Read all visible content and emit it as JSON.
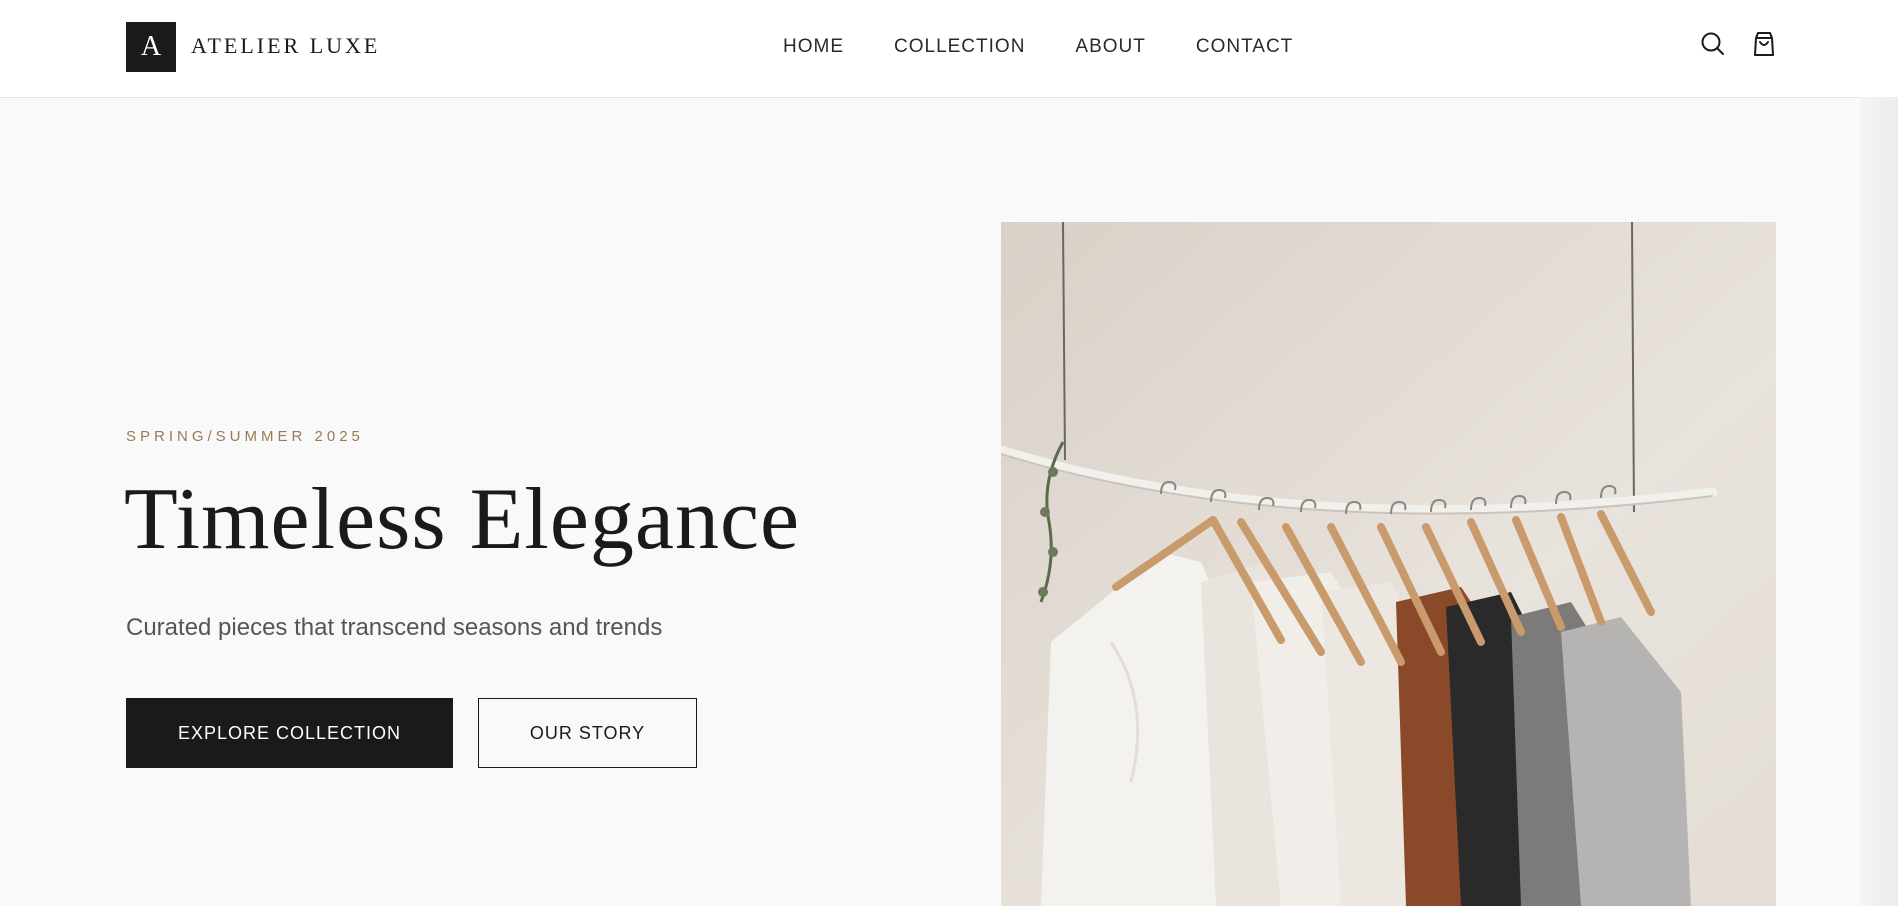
{
  "brand": {
    "mark": "A",
    "name": "ATELIER LUXE"
  },
  "nav": {
    "items": [
      {
        "label": "HOME"
      },
      {
        "label": "COLLECTION"
      },
      {
        "label": "ABOUT"
      },
      {
        "label": "CONTACT"
      }
    ]
  },
  "header_icons": [
    "search-icon",
    "shopping-bag-icon"
  ],
  "hero": {
    "eyebrow": "SPRING/SUMMER 2025",
    "title": "Timeless Elegance",
    "subtitle": "Curated pieces that transcend seasons and trends",
    "primary_button": "EXPLORE COLLECTION",
    "secondary_button": "OUR STORY",
    "image": "clothing-rack-photo"
  },
  "colors": {
    "accent": "#9a7a55",
    "primary": "#1a1a1a",
    "background": "#f9f9f9",
    "header": "#ffffff"
  }
}
